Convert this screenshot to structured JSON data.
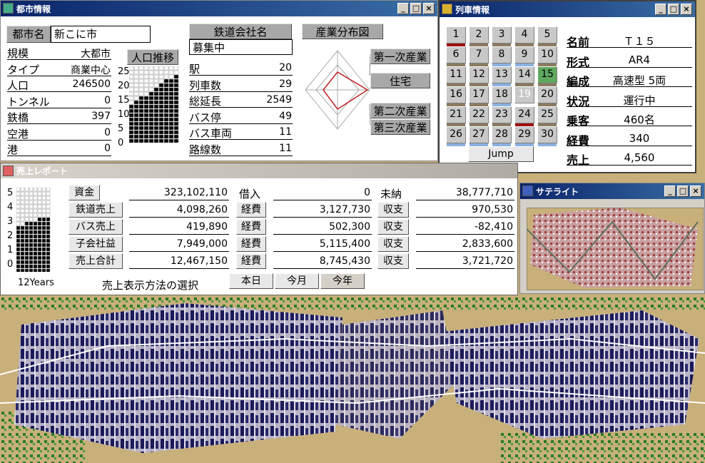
{
  "city_window": {
    "title": "都市情報",
    "name_label": "都市名",
    "name_value": "新こに市",
    "stats": [
      {
        "label": "規模",
        "value": "大都市"
      },
      {
        "label": "タイプ",
        "value": "商業中心"
      },
      {
        "label": "人口",
        "value": "246500"
      },
      {
        "label": "トンネル",
        "value": "0"
      },
      {
        "label": "鉄橋",
        "value": "397"
      },
      {
        "label": "空港",
        "value": "0"
      },
      {
        "label": "港",
        "value": "0"
      }
    ],
    "pop_button": "人口推移",
    "pop_ticks": [
      "25",
      "20",
      "15",
      "10",
      "5",
      "0"
    ],
    "rail_company_button": "鉄道会社名",
    "rail_company_value": "募集中",
    "rail_stats": [
      {
        "label": "駅",
        "value": "20"
      },
      {
        "label": "列車数",
        "value": "29"
      },
      {
        "label": "総延長",
        "value": "2549"
      },
      {
        "label": "バス停",
        "value": "49"
      },
      {
        "label": "バス車両",
        "value": "11"
      },
      {
        "label": "路線数",
        "value": "11"
      }
    ],
    "industry_button": "産業分布図",
    "industry_labels": [
      "第一次産業",
      "住宅",
      "第二次産業",
      "第三次産業"
    ]
  },
  "train_window": {
    "title": "列車情報",
    "cells": [
      {
        "n": "1",
        "bar": "#a01010"
      },
      {
        "n": "2",
        "bar": "#8a7a60"
      },
      {
        "n": "3",
        "bar": "#8a7a60"
      },
      {
        "n": "4",
        "bar": "#8a7a60"
      },
      {
        "n": "5",
        "bar": "#8a7a60"
      },
      {
        "n": "6",
        "bar": "#8a7a60"
      },
      {
        "n": "7",
        "bar": "#8a7a60"
      },
      {
        "n": "8",
        "bar": "#8ab0e0"
      },
      {
        "n": "9",
        "bar": "#8ab0e0"
      },
      {
        "n": "10",
        "bar": "#8a7a60"
      },
      {
        "n": "11",
        "bar": "#8a7a60"
      },
      {
        "n": "12",
        "bar": "#8a7a60"
      },
      {
        "n": "13",
        "bar": "#8ab0e0"
      },
      {
        "n": "14",
        "bar": "#8a7a60"
      },
      {
        "n": "15",
        "bar": "#8a7a60"
      },
      {
        "n": "16",
        "bar": "#8a7a60"
      },
      {
        "n": "17",
        "bar": "#8a7a60"
      },
      {
        "n": "18",
        "bar": "#8ab0e0"
      },
      {
        "n": "19",
        "bar": ""
      },
      {
        "n": "20",
        "bar": "#8a7a60"
      },
      {
        "n": "21",
        "bar": "#8a7a60"
      },
      {
        "n": "22",
        "bar": "#8a7a60"
      },
      {
        "n": "23",
        "bar": "#8a7a60"
      },
      {
        "n": "24",
        "bar": "#a01010"
      },
      {
        "n": "25",
        "bar": "#8a7a60"
      },
      {
        "n": "26",
        "bar": "#8ab0e0"
      },
      {
        "n": "27",
        "bar": "#8ab0e0"
      },
      {
        "n": "28",
        "bar": "#8ab0e0"
      },
      {
        "n": "29",
        "bar": "#8ab0e0"
      },
      {
        "n": "30",
        "bar": "#8ab0e0"
      }
    ],
    "jump_label": "Jump",
    "info": [
      {
        "label": "名前",
        "value": "Ｔ１５"
      },
      {
        "label": "形式",
        "value": "AR4"
      },
      {
        "label": "編成",
        "value": "高速型 5両"
      },
      {
        "label": "状況",
        "value": "運行中"
      },
      {
        "label": "乗客",
        "value": "460名"
      },
      {
        "label": "経費",
        "value": "340"
      },
      {
        "label": "売上",
        "value": "4,560"
      }
    ]
  },
  "sales_window": {
    "title": "売上レポート",
    "ticks": [
      "5",
      "4",
      "3",
      "2",
      "1",
      "0"
    ],
    "years_label": "12Years",
    "rows": [
      {
        "label": "資金",
        "value": "323,102,110",
        "mid_label": "借入",
        "mid_value": "0",
        "right_label": "未納",
        "right_value": "38,777,710"
      },
      {
        "label": "鉄道売上",
        "value": "4,098,260",
        "mid_label": "経費",
        "mid_value": "3,127,730",
        "right_label": "収支",
        "right_value": "970,530"
      },
      {
        "label": "バス売上",
        "value": "419,890",
        "mid_label": "経費",
        "mid_value": "502,300",
        "right_label": "収支",
        "right_value": "-82,410"
      },
      {
        "label": "子会社益",
        "value": "7,949,000",
        "mid_label": "経費",
        "mid_value": "5,115,400",
        "right_label": "収支",
        "right_value": "2,833,600"
      },
      {
        "label": "売上合計",
        "value": "12,467,150",
        "mid_label": "経費",
        "mid_value": "8,745,430",
        "right_label": "収支",
        "right_value": "3,721,720"
      }
    ],
    "period_label": "売上表示方法の選択",
    "periods": [
      "本日",
      "今月",
      "今年"
    ]
  },
  "satellite_window": {
    "title": "サテライト"
  },
  "colors": {
    "title_active": "#0a246a",
    "button_gray": "#a8a8a8",
    "chart_dark": "#000000",
    "map_sand": "#c8b07a",
    "highlight_cell": "#5fa85f"
  }
}
